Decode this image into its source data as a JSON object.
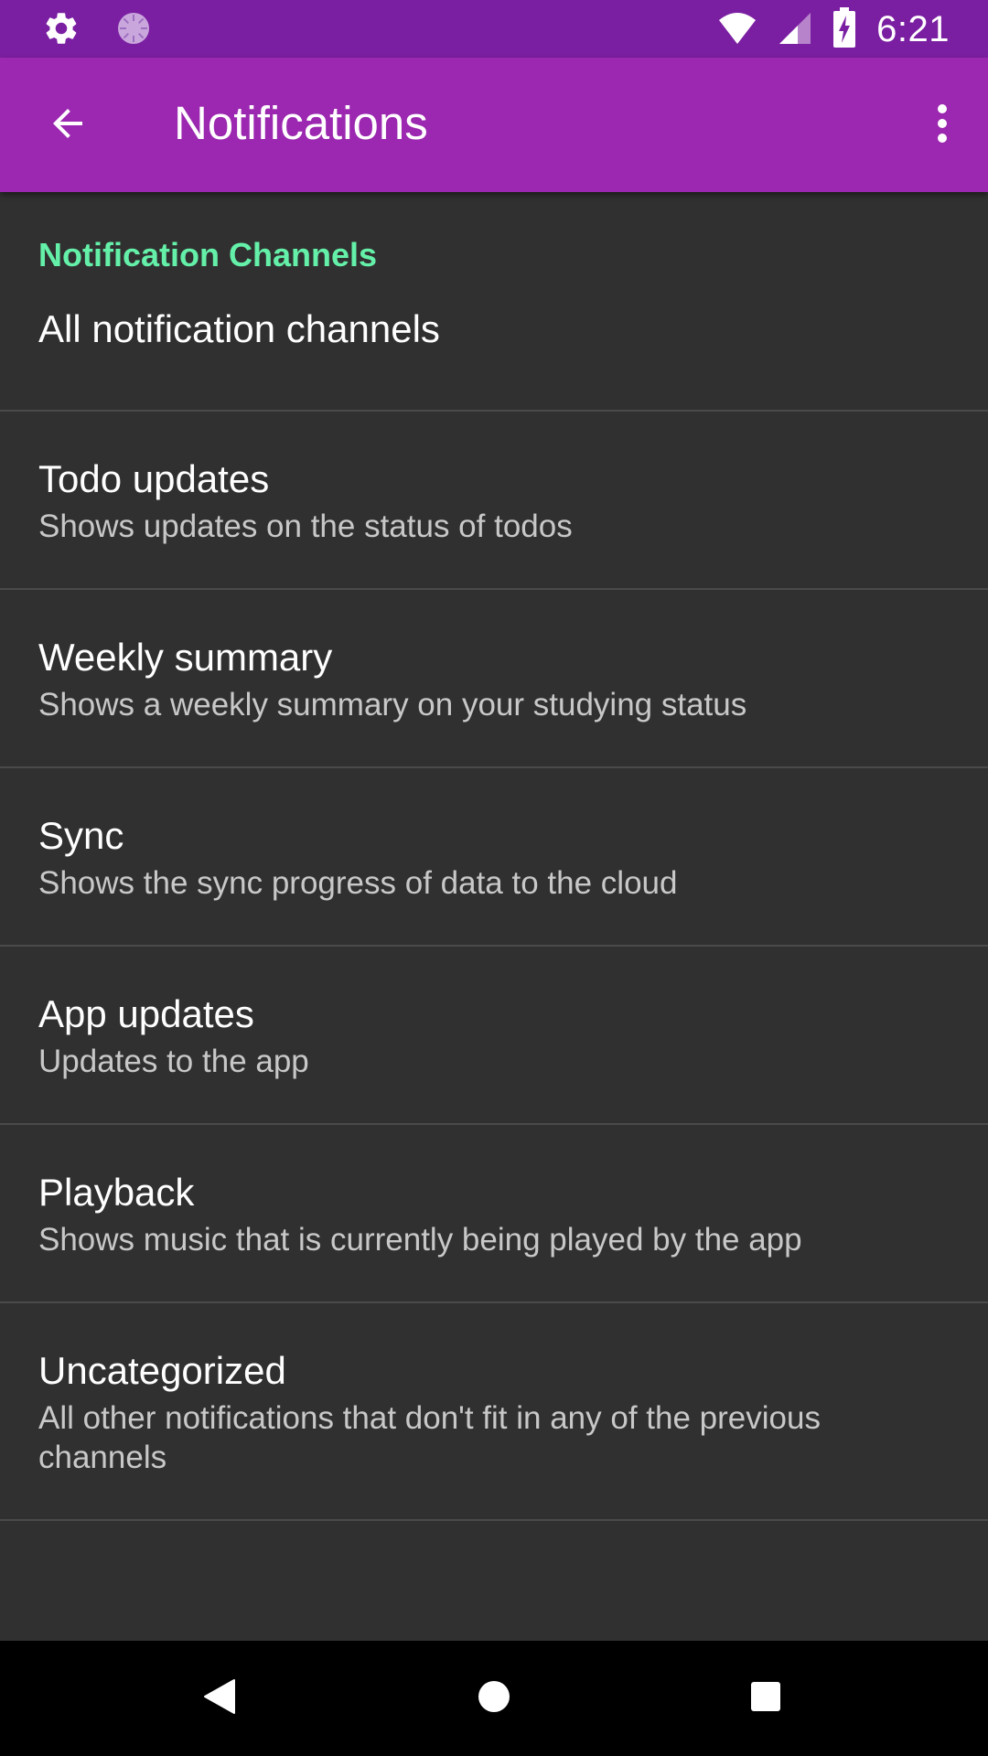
{
  "status_bar": {
    "time": "6:21",
    "icons": [
      "gear-icon",
      "sync-spinner-icon",
      "wifi-icon",
      "cell-signal-icon",
      "battery-charging-icon"
    ]
  },
  "app_bar": {
    "title": "Notifications",
    "back_icon": "arrow-back-icon",
    "overflow_icon": "more-vert-icon"
  },
  "section": {
    "header": "Notification Channels"
  },
  "items": [
    {
      "title": "All notification channels",
      "summary": ""
    },
    {
      "title": "Todo updates",
      "summary": "Shows updates on the status of todos"
    },
    {
      "title": "Weekly summary",
      "summary": "Shows a weekly summary on your studying status"
    },
    {
      "title": "Sync",
      "summary": "Shows the sync progress of data to the cloud"
    },
    {
      "title": "App updates",
      "summary": "Updates to the app"
    },
    {
      "title": "Playback",
      "summary": "Shows music that is currently being played by the app"
    },
    {
      "title": "Uncategorized",
      "summary": "All other notifications that don't fit in any of the previous channels"
    }
  ],
  "colors": {
    "status_bar": "#7b1fa2",
    "app_bar": "#9c27b0",
    "background": "#303030",
    "accent": "#64f0a8",
    "divider": "#4a4a4a"
  },
  "nav_bar": {
    "icons": [
      "nav-back-icon",
      "nav-home-icon",
      "nav-recents-icon"
    ]
  }
}
